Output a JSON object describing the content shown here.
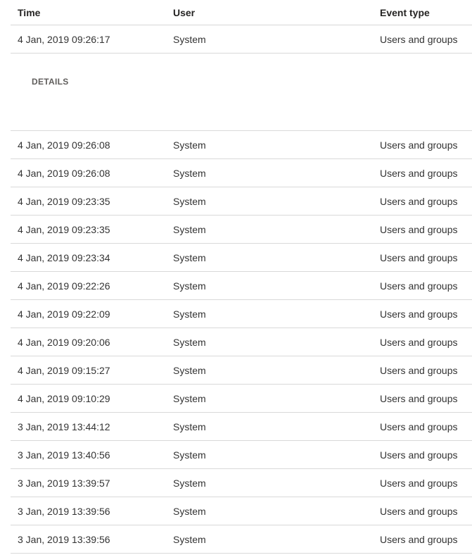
{
  "table": {
    "headers": {
      "time": "Time",
      "user": "User",
      "event_type": "Event type"
    },
    "expanded_row": {
      "time": "4 Jan, 2019 09:26:17",
      "user": "System",
      "event_type": "Users and groups",
      "details_label": "DETAILS"
    },
    "rows": [
      {
        "time": "4 Jan, 2019 09:26:08",
        "user": "System",
        "event_type": "Users and groups"
      },
      {
        "time": "4 Jan, 2019 09:26:08",
        "user": "System",
        "event_type": "Users and groups"
      },
      {
        "time": "4 Jan, 2019 09:23:35",
        "user": "System",
        "event_type": "Users and groups"
      },
      {
        "time": "4 Jan, 2019 09:23:35",
        "user": "System",
        "event_type": "Users and groups"
      },
      {
        "time": "4 Jan, 2019 09:23:34",
        "user": "System",
        "event_type": "Users and groups"
      },
      {
        "time": "4 Jan, 2019 09:22:26",
        "user": "System",
        "event_type": "Users and groups"
      },
      {
        "time": "4 Jan, 2019 09:22:09",
        "user": "System",
        "event_type": "Users and groups"
      },
      {
        "time": "4 Jan, 2019 09:20:06",
        "user": "System",
        "event_type": "Users and groups"
      },
      {
        "time": "4 Jan, 2019 09:15:27",
        "user": "System",
        "event_type": "Users and groups"
      },
      {
        "time": "4 Jan, 2019 09:10:29",
        "user": "System",
        "event_type": "Users and groups"
      },
      {
        "time": "3 Jan, 2019 13:44:12",
        "user": "System",
        "event_type": "Users and groups"
      },
      {
        "time": "3 Jan, 2019 13:40:56",
        "user": "System",
        "event_type": "Users and groups"
      },
      {
        "time": "3 Jan, 2019 13:39:57",
        "user": "System",
        "event_type": "Users and groups"
      },
      {
        "time": "3 Jan, 2019 13:39:56",
        "user": "System",
        "event_type": "Users and groups"
      },
      {
        "time": "3 Jan, 2019 13:39:56",
        "user": "System",
        "event_type": "Users and groups"
      }
    ]
  }
}
